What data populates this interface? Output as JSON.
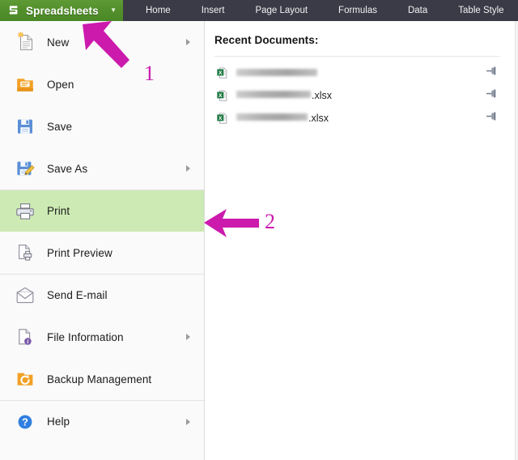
{
  "window": {
    "brand": {
      "title": "Spreadsheets",
      "logo_icon": "s-logo-icon",
      "dropdown_icon": "chevron-down-icon",
      "color": "#53902c"
    },
    "tabs": [
      {
        "label": "Home"
      },
      {
        "label": "Insert"
      },
      {
        "label": "Page Layout"
      },
      {
        "label": "Formulas"
      },
      {
        "label": "Data"
      },
      {
        "label": "Table Style"
      }
    ],
    "tabbar_color": "#3b3b47"
  },
  "sidebar": {
    "highlight_color": "#cdeab4",
    "items": [
      {
        "label": "New",
        "icon": "new-document-icon",
        "has_submenu": true,
        "active": false,
        "separator_above": false
      },
      {
        "label": "Open",
        "icon": "open-folder-icon",
        "has_submenu": false,
        "active": false,
        "separator_above": false
      },
      {
        "label": "Save",
        "icon": "floppy-disk-icon",
        "has_submenu": false,
        "active": false,
        "separator_above": false
      },
      {
        "label": "Save As",
        "icon": "floppy-disk-pencil-icon",
        "has_submenu": true,
        "active": false,
        "separator_above": false
      },
      {
        "label": "Print",
        "icon": "printer-icon",
        "has_submenu": false,
        "active": true,
        "separator_above": true
      },
      {
        "label": "Print Preview",
        "icon": "print-preview-icon",
        "has_submenu": false,
        "active": false,
        "separator_above": false
      },
      {
        "label": "Send E-mail",
        "icon": "envelope-icon",
        "has_submenu": false,
        "active": false,
        "separator_above": true
      },
      {
        "label": "File Information",
        "icon": "file-info-icon",
        "has_submenu": true,
        "active": false,
        "separator_above": false
      },
      {
        "label": "Backup Management",
        "icon": "backup-folder-icon",
        "has_submenu": false,
        "active": false,
        "separator_above": false
      },
      {
        "label": "Help",
        "icon": "help-circle-icon",
        "has_submenu": true,
        "active": false,
        "separator_above": true
      }
    ]
  },
  "recent_documents": {
    "title": "Recent Documents:",
    "pin_icon": "pushpin-icon",
    "file_icon": "excel-file-icon",
    "files": [
      {
        "name_redacted": true,
        "redacted_width": 100,
        "extension": "",
        "pinned": false
      },
      {
        "name_redacted": true,
        "redacted_width": 92,
        "extension": ".xlsx",
        "pinned": false
      },
      {
        "name_redacted": true,
        "redacted_width": 88,
        "extension": ".xlsx",
        "pinned": false
      }
    ]
  },
  "annotations": {
    "color": "#cc1aad",
    "markers": [
      {
        "label": "1",
        "points_to": "spreadsheets-menu-button",
        "direction": "up-left"
      },
      {
        "label": "2",
        "points_to": "sidebar-item-print",
        "direction": "left"
      }
    ]
  }
}
